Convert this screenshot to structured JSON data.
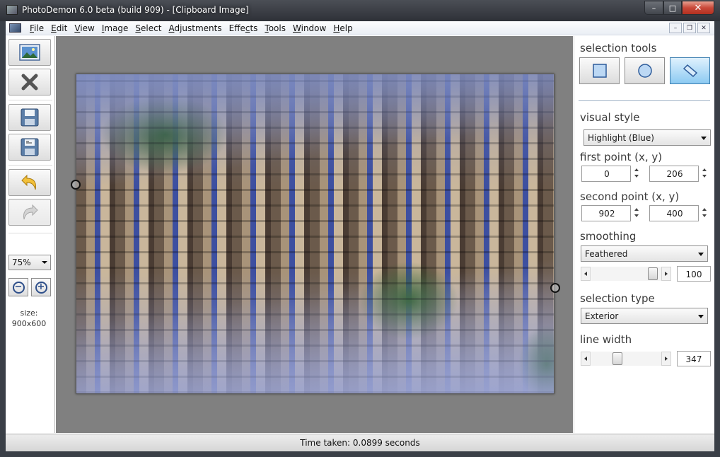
{
  "window": {
    "title": "PhotoDemon 6.0 beta (build 909) - [Clipboard Image]",
    "min_glyph": "–",
    "max_glyph": "□",
    "close_glyph": "✕"
  },
  "menubar": {
    "items": [
      {
        "ul": "F",
        "rest": "ile"
      },
      {
        "ul": "E",
        "rest": "dit"
      },
      {
        "ul": "V",
        "rest": "iew"
      },
      {
        "ul": "I",
        "rest": "mage"
      },
      {
        "ul": "S",
        "rest": "elect"
      },
      {
        "ul": "A",
        "rest": "djustments"
      },
      {
        "ul": "",
        "pre": "Effe",
        "mid": "c",
        "rest": "ts"
      },
      {
        "ul": "T",
        "rest": "ools"
      },
      {
        "ul": "W",
        "rest": "indow"
      },
      {
        "ul": "H",
        "rest": "elp"
      }
    ],
    "mdi_min": "–",
    "mdi_restore": "❐",
    "mdi_close": "✕"
  },
  "left_toolbar": {
    "icons": [
      "open-image-icon",
      "close-image-icon",
      "save-icon",
      "save-as-icon",
      "undo-icon",
      "redo-icon"
    ],
    "zoom_value": "75%",
    "zoom_out_glyph": "−",
    "zoom_in_glyph": "+",
    "size_label": "size:",
    "size_value": "900x600"
  },
  "right_panel": {
    "selection_tools_label": "selection tools",
    "selection_tools": [
      "rectangle-select-icon",
      "ellipse-select-icon",
      "line-select-icon"
    ],
    "active_tool": "line-select-icon",
    "visual_style_label": "visual style",
    "visual_style_value": "Highlight (Blue)",
    "first_point_label": "first point (x, y)",
    "first_point_x": "0",
    "first_point_y": "206",
    "second_point_label": "second point (x, y)",
    "second_point_x": "902",
    "second_point_y": "400",
    "smoothing_label": "smoothing",
    "smoothing_value": "Feathered",
    "smoothing_amount": "100",
    "selection_type_label": "selection type",
    "selection_type_value": "Exterior",
    "line_width_label": "line width",
    "line_width_value": "347"
  },
  "status": {
    "text": "Time taken: 0.0899 seconds"
  },
  "colors": {
    "canvas_bg": "#808080",
    "active_tool_bg": "#8ccaf2",
    "titlebar": "#2e3137"
  }
}
